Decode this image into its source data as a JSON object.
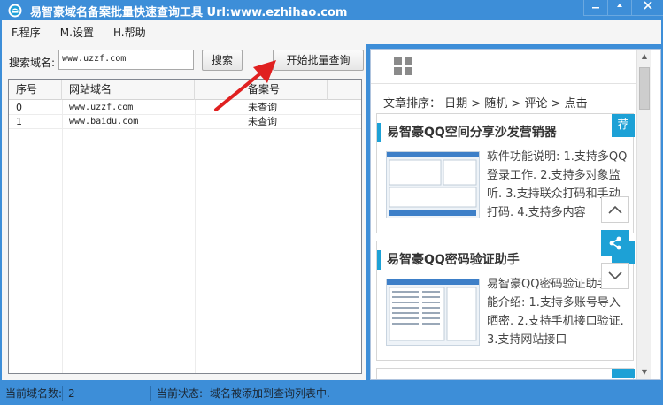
{
  "window": {
    "title": "易智豪域名备案批量快速查询工具 Url:www.ezhihao.com",
    "min_icon": "minimize-icon",
    "max_icon": "maximize-icon",
    "close_icon": "close-icon"
  },
  "menu": {
    "items": [
      {
        "label": "F.程序"
      },
      {
        "label": "M.设置"
      },
      {
        "label": "H.帮助"
      }
    ]
  },
  "search": {
    "label": "搜索域名:",
    "value": "www.uzzf.com",
    "search_button": "搜索",
    "batch_button": "开始批量查询"
  },
  "grid": {
    "columns": [
      "序号",
      "网站域名",
      "备案号"
    ],
    "rows": [
      {
        "index": "0",
        "domain": "www.uzzf.com",
        "record": "未查询"
      },
      {
        "index": "1",
        "domain": "www.baidu.com",
        "record": "未查询"
      }
    ]
  },
  "ad": {
    "sort_text": "文章排序： 日期 > 随机 > 评论 > 点击",
    "cards": [
      {
        "title": "易智豪QQ空间分享沙发营销器",
        "desc": "软件功能说明: 1.支持多QQ登录工作. 2.支持多对象监听. 3.支持联众打码和手动打码. 4.支持多内容",
        "tag": "荐"
      },
      {
        "title": "易智豪QQ密码验证助手",
        "desc": "易智豪QQ密码验证助手功能介绍: 1.支持多账号导入晒密. 2.支持手机接口验证. 3.支持网站接口"
      }
    ]
  },
  "status": {
    "count_label": "当前域名数:",
    "count_value": "2",
    "state_label": "当前状态:",
    "state_value": "域名被添加到查询列表中."
  },
  "colors": {
    "frame": "#3d8ed8",
    "accent": "#1da1d6",
    "arrow": "#e02020"
  }
}
